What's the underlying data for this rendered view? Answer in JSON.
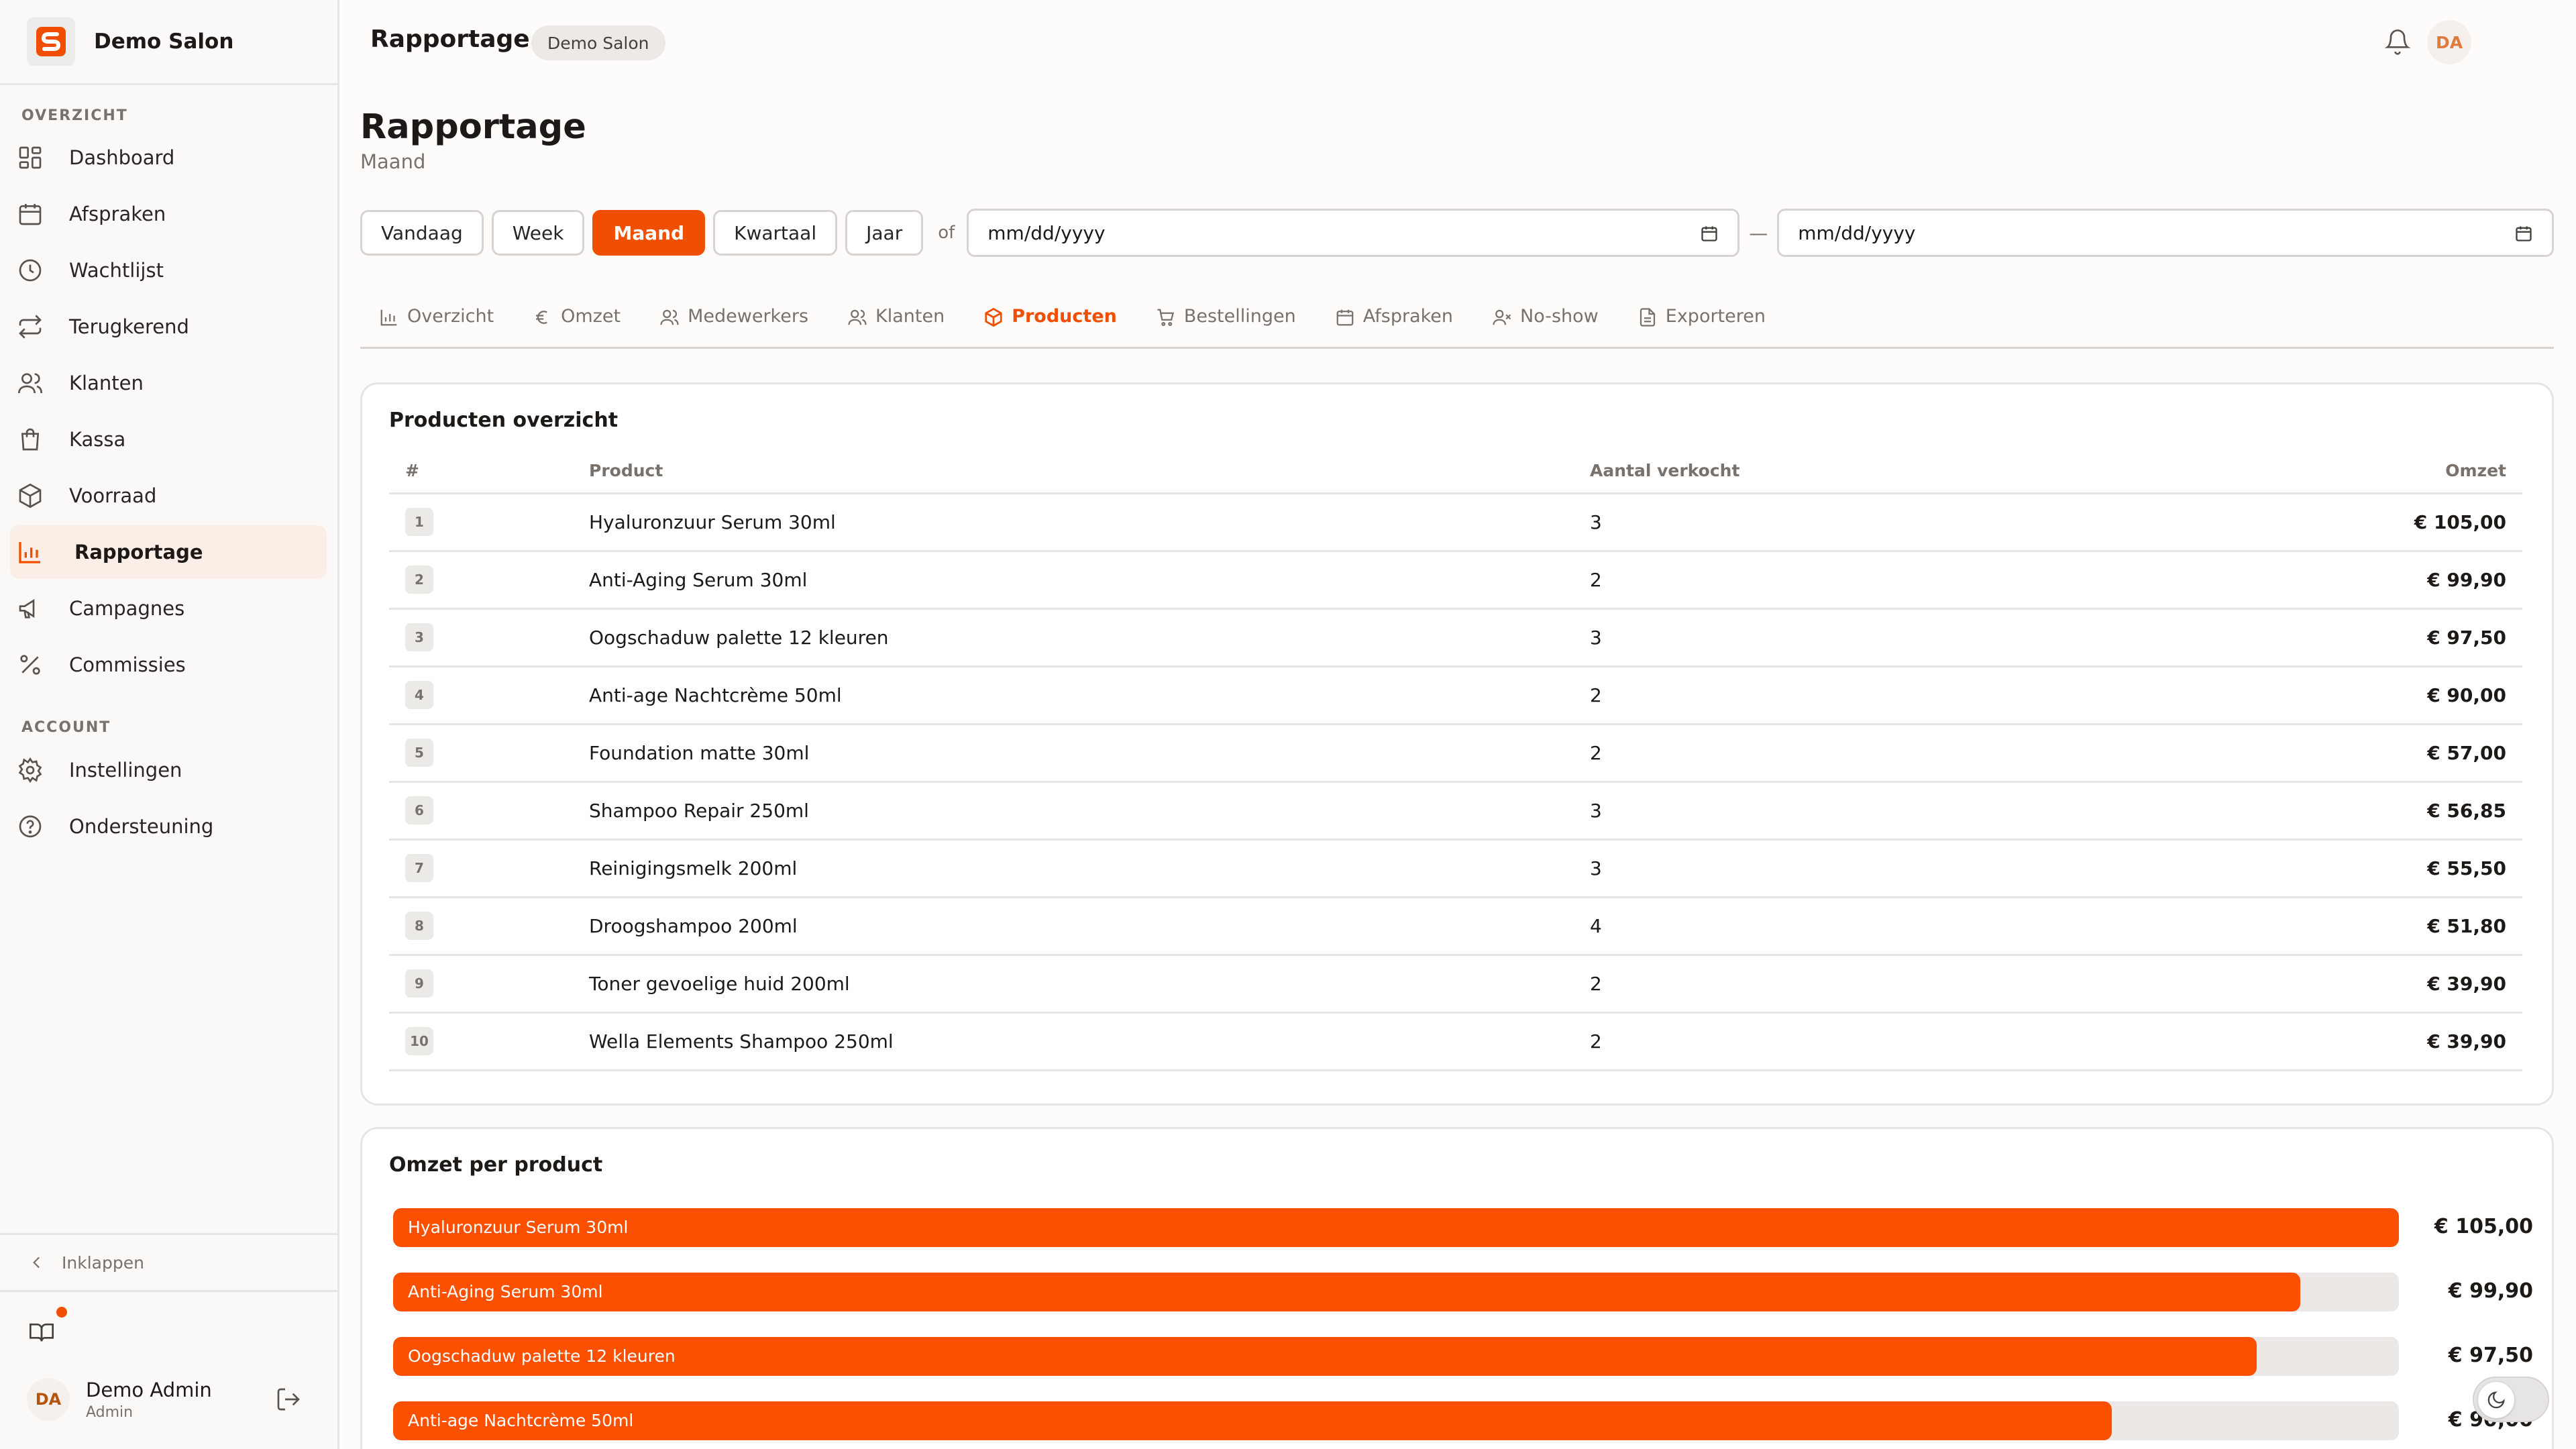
{
  "brand": {
    "name": "Demo Salon",
    "logo_letter": "S"
  },
  "sidebar": {
    "section_overview": "OVERZICHT",
    "section_account": "ACCOUNT",
    "items": [
      {
        "label": "Dashboard",
        "icon": "dashboard-icon"
      },
      {
        "label": "Afspraken",
        "icon": "calendar-icon"
      },
      {
        "label": "Wachtlijst",
        "icon": "clock-icon"
      },
      {
        "label": "Terugkerend",
        "icon": "repeat-icon"
      },
      {
        "label": "Klanten",
        "icon": "users-icon"
      },
      {
        "label": "Kassa",
        "icon": "shopping-bag-icon"
      },
      {
        "label": "Voorraad",
        "icon": "package-icon"
      },
      {
        "label": "Rapportage",
        "icon": "bar-chart-icon",
        "active": true
      },
      {
        "label": "Campagnes",
        "icon": "megaphone-icon"
      },
      {
        "label": "Commissies",
        "icon": "percent-icon"
      }
    ],
    "account_items": [
      {
        "label": "Instellingen",
        "icon": "gear-icon"
      },
      {
        "label": "Ondersteuning",
        "icon": "help-circle-icon"
      }
    ],
    "collapse_label": "Inklappen",
    "user": {
      "initials": "DA",
      "name": "Demo Admin",
      "role": "Admin"
    }
  },
  "topbar": {
    "title": "Rapportage",
    "badge": "Demo Salon",
    "avatar_initials": "DA"
  },
  "page": {
    "title": "Rapportage",
    "subtitle": "Maand"
  },
  "periods": {
    "vandaag": "Vandaag",
    "week": "Week",
    "maand": "Maand",
    "kwartaal": "Kwartaal",
    "jaar": "Jaar",
    "active": "Maand"
  },
  "date_range": {
    "or_label": "of",
    "separator": "—",
    "start_placeholder": "mm/dd/yyyy",
    "end_placeholder": "mm/dd/yyyy"
  },
  "tabs": [
    {
      "label": "Overzicht",
      "icon": "bar-chart-icon"
    },
    {
      "label": "Omzet",
      "icon": "euro-icon"
    },
    {
      "label": "Medewerkers",
      "icon": "users-icon"
    },
    {
      "label": "Klanten",
      "icon": "users-icon"
    },
    {
      "label": "Producten",
      "icon": "package-icon",
      "active": true
    },
    {
      "label": "Bestellingen",
      "icon": "cart-icon"
    },
    {
      "label": "Afspraken",
      "icon": "calendar-icon"
    },
    {
      "label": "No-show",
      "icon": "user-x-icon"
    },
    {
      "label": "Exporteren",
      "icon": "file-icon"
    }
  ],
  "products_overview": {
    "title": "Producten overzicht",
    "columns": {
      "rank": "#",
      "product": "Product",
      "qty": "Aantal verkocht",
      "revenue": "Omzet"
    },
    "rows": [
      {
        "rank": "1",
        "product": "Hyaluronzuur Serum 30ml",
        "qty": "3",
        "revenue": "€ 105,00"
      },
      {
        "rank": "2",
        "product": "Anti-Aging Serum 30ml",
        "qty": "2",
        "revenue": "€ 99,90"
      },
      {
        "rank": "3",
        "product": "Oogschaduw palette 12 kleuren",
        "qty": "3",
        "revenue": "€ 97,50"
      },
      {
        "rank": "4",
        "product": "Anti-age Nachtcrème 50ml",
        "qty": "2",
        "revenue": "€ 90,00"
      },
      {
        "rank": "5",
        "product": "Foundation matte 30ml",
        "qty": "2",
        "revenue": "€ 57,00"
      },
      {
        "rank": "6",
        "product": "Shampoo Repair 250ml",
        "qty": "3",
        "revenue": "€ 56,85"
      },
      {
        "rank": "7",
        "product": "Reinigingsmelk 200ml",
        "qty": "3",
        "revenue": "€ 55,50"
      },
      {
        "rank": "8",
        "product": "Droogshampoo 200ml",
        "qty": "4",
        "revenue": "€ 51,80"
      },
      {
        "rank": "9",
        "product": "Toner gevoelige huid 200ml",
        "qty": "2",
        "revenue": "€ 39,90"
      },
      {
        "rank": "10",
        "product": "Wella Elements Shampoo 250ml",
        "qty": "2",
        "revenue": "€ 39,90"
      }
    ]
  },
  "revenue_per_product": {
    "title": "Omzet per product",
    "accent_color": "#fa5000",
    "bars": [
      {
        "label": "Hyaluronzuur Serum 30ml",
        "value_text": "€ 105,00",
        "fraction": 1.0
      },
      {
        "label": "Anti-Aging Serum 30ml",
        "value_text": "€ 99,90",
        "fraction": 0.951
      },
      {
        "label": "Oogschaduw palette 12 kleuren",
        "value_text": "€ 97,50",
        "fraction": 0.929
      },
      {
        "label": "Anti-age Nachtcrème 50ml",
        "value_text": "€ 90,00",
        "fraction": 0.857
      }
    ]
  },
  "colors": {
    "accent": "#f04e00",
    "active_nav_bg": "#fbeee6"
  }
}
